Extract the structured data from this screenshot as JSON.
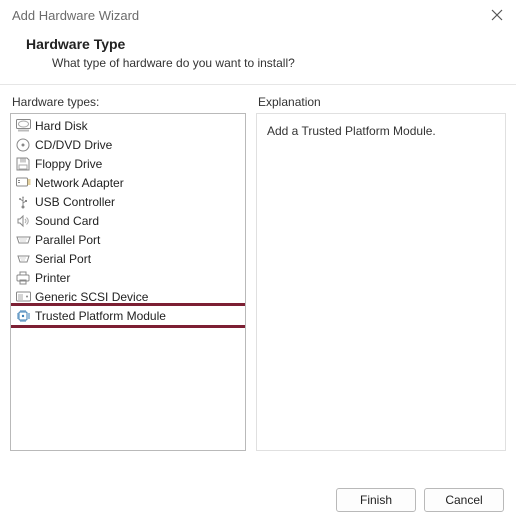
{
  "window": {
    "title": "Add Hardware Wizard"
  },
  "header": {
    "title": "Hardware Type",
    "subtitle": "What type of hardware do you want to install?"
  },
  "leftColumn": {
    "label": "Hardware types:"
  },
  "hardwareTypes": [
    {
      "icon": "hard-disk-icon",
      "label": "Hard Disk"
    },
    {
      "icon": "cd-dvd-icon",
      "label": "CD/DVD Drive"
    },
    {
      "icon": "floppy-icon",
      "label": "Floppy Drive"
    },
    {
      "icon": "network-adapter-icon",
      "label": "Network Adapter"
    },
    {
      "icon": "usb-controller-icon",
      "label": "USB Controller"
    },
    {
      "icon": "sound-card-icon",
      "label": "Sound Card"
    },
    {
      "icon": "parallel-port-icon",
      "label": "Parallel Port"
    },
    {
      "icon": "serial-port-icon",
      "label": "Serial Port"
    },
    {
      "icon": "printer-icon",
      "label": "Printer"
    },
    {
      "icon": "scsi-device-icon",
      "label": "Generic SCSI Device"
    },
    {
      "icon": "tpm-icon",
      "label": "Trusted Platform Module"
    }
  ],
  "selectedIndex": 10,
  "rightColumn": {
    "label": "Explanation",
    "text": "Add a Trusted Platform Module."
  },
  "buttons": {
    "finish": "Finish",
    "cancel": "Cancel"
  },
  "annotation": {
    "highlightColor": "#7c1f33"
  }
}
